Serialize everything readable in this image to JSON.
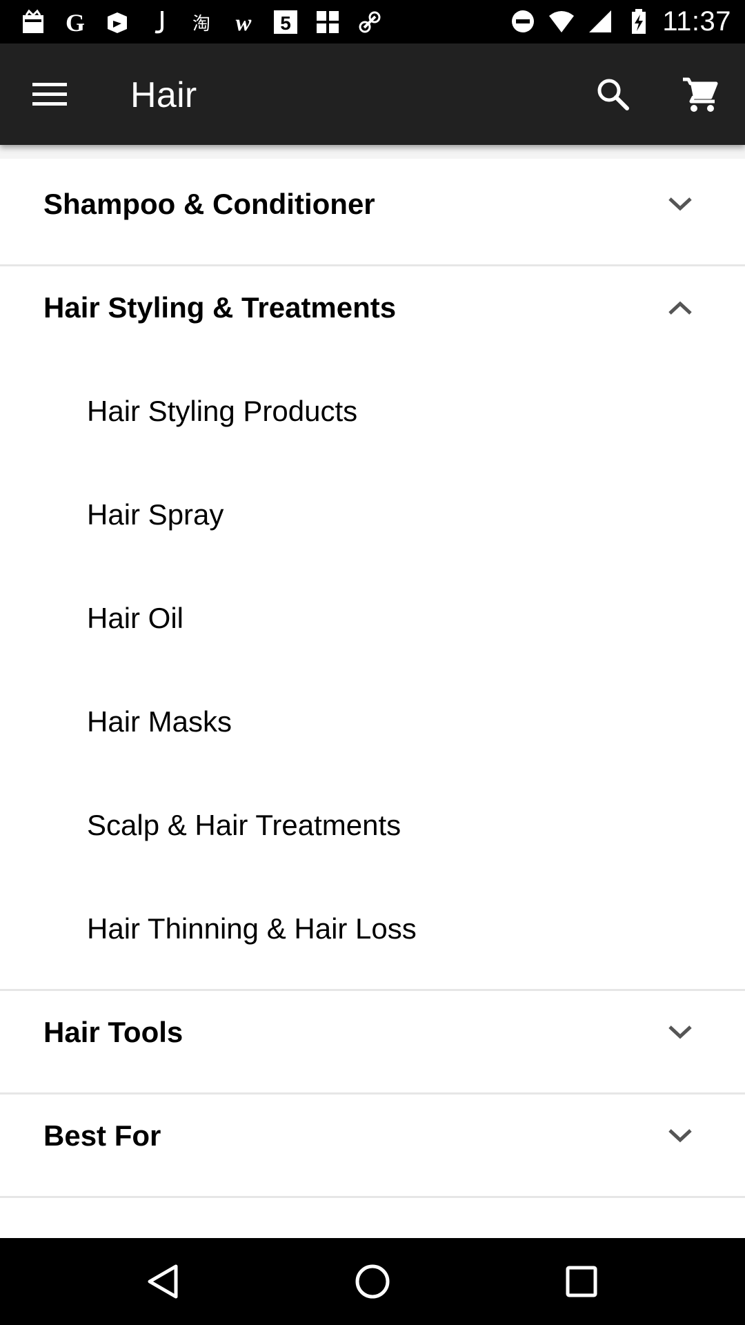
{
  "status_bar": {
    "notification_icons": [
      "gift-box-icon",
      "google-icon",
      "photo-app-icon",
      "j-app-icon",
      "taobao-icon",
      "w-app-icon",
      "five-app-icon",
      "grid-app-icon",
      "link-app-icon"
    ],
    "system_icons": [
      "do-not-disturb-icon",
      "wifi-icon",
      "signal-icon",
      "battery-charging-icon"
    ],
    "time": "11:37"
  },
  "toolbar": {
    "title": "Hair",
    "menu_icon": "hamburger-menu-icon",
    "search_icon": "search-icon",
    "cart_icon": "shopping-cart-icon"
  },
  "categories": [
    {
      "label": "Shampoo & Conditioner",
      "expanded": false
    },
    {
      "label": "Hair Styling & Treatments",
      "expanded": true,
      "children": [
        "Hair Styling Products",
        "Hair Spray",
        "Hair Oil",
        "Hair Masks",
        "Scalp & Hair Treatments",
        "Hair Thinning & Hair Loss"
      ]
    },
    {
      "label": "Hair Tools",
      "expanded": false
    },
    {
      "label": "Best For",
      "expanded": false
    }
  ],
  "nav_bar": {
    "back_icon": "back-triangle-icon",
    "home_icon": "home-circle-icon",
    "recents_icon": "recents-square-icon"
  },
  "colors": {
    "toolbar_bg": "#212121",
    "status_bar_bg": "#000000",
    "divider": "#e6e6e6",
    "chevron": "#555555"
  }
}
